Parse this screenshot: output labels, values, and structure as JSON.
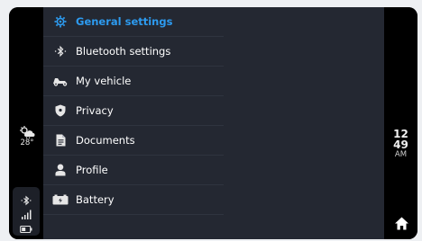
{
  "weather": {
    "icon": "partly-cloudy-rain-icon",
    "temperature": "28°"
  },
  "status": {
    "icons": [
      "bluetooth-icon",
      "signal-icon",
      "battery-icon"
    ]
  },
  "clock": {
    "hour": "12",
    "minute": "49",
    "ampm": "AM"
  },
  "menu": {
    "items": [
      {
        "label": "General settings",
        "icon": "gear-icon",
        "active": true
      },
      {
        "label": "Bluetooth settings",
        "icon": "bluetooth-icon",
        "active": false
      },
      {
        "label": "My vehicle",
        "icon": "scooter-icon",
        "active": false
      },
      {
        "label": "Privacy",
        "icon": "shield-icon",
        "active": false
      },
      {
        "label": "Documents",
        "icon": "document-icon",
        "active": false
      },
      {
        "label": "Profile",
        "icon": "person-icon",
        "active": false
      },
      {
        "label": "Battery",
        "icon": "battery-icon",
        "active": false
      }
    ]
  },
  "colors": {
    "accent": "#2d9bf0",
    "panel": "#242832",
    "rail": "#000000"
  },
  "home": {
    "icon": "home-icon"
  }
}
